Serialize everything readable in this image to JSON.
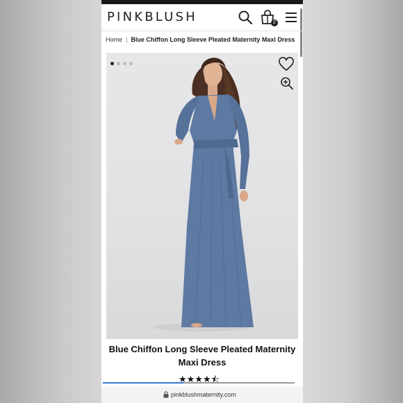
{
  "header": {
    "logo": "PINKBLUSH",
    "bag_count": "2",
    "icons": [
      "search-icon",
      "shopping-bag-icon",
      "hamburger-menu-icon"
    ]
  },
  "breadcrumb": {
    "home": "Home",
    "separator": "|",
    "current": "Blue Chiffon Long Sleeve Pleated Maternity Maxi Dress"
  },
  "gallery": {
    "dot_count": 4,
    "active_dot": 0,
    "icons": [
      "heart-icon",
      "zoom-in-icon"
    ]
  },
  "product": {
    "title": "Blue Chiffon Long Sleeve Pleated Maternity Maxi Dress",
    "rating": 4.5,
    "rating_max": 5,
    "stars": "★★★★⯪"
  },
  "browser": {
    "url": "pinkblushmaternity.com",
    "load_progress": 0.42
  },
  "colors": {
    "dress": "#5e7aa3",
    "accent_progress": "#3a78d8",
    "text": "#111111"
  }
}
